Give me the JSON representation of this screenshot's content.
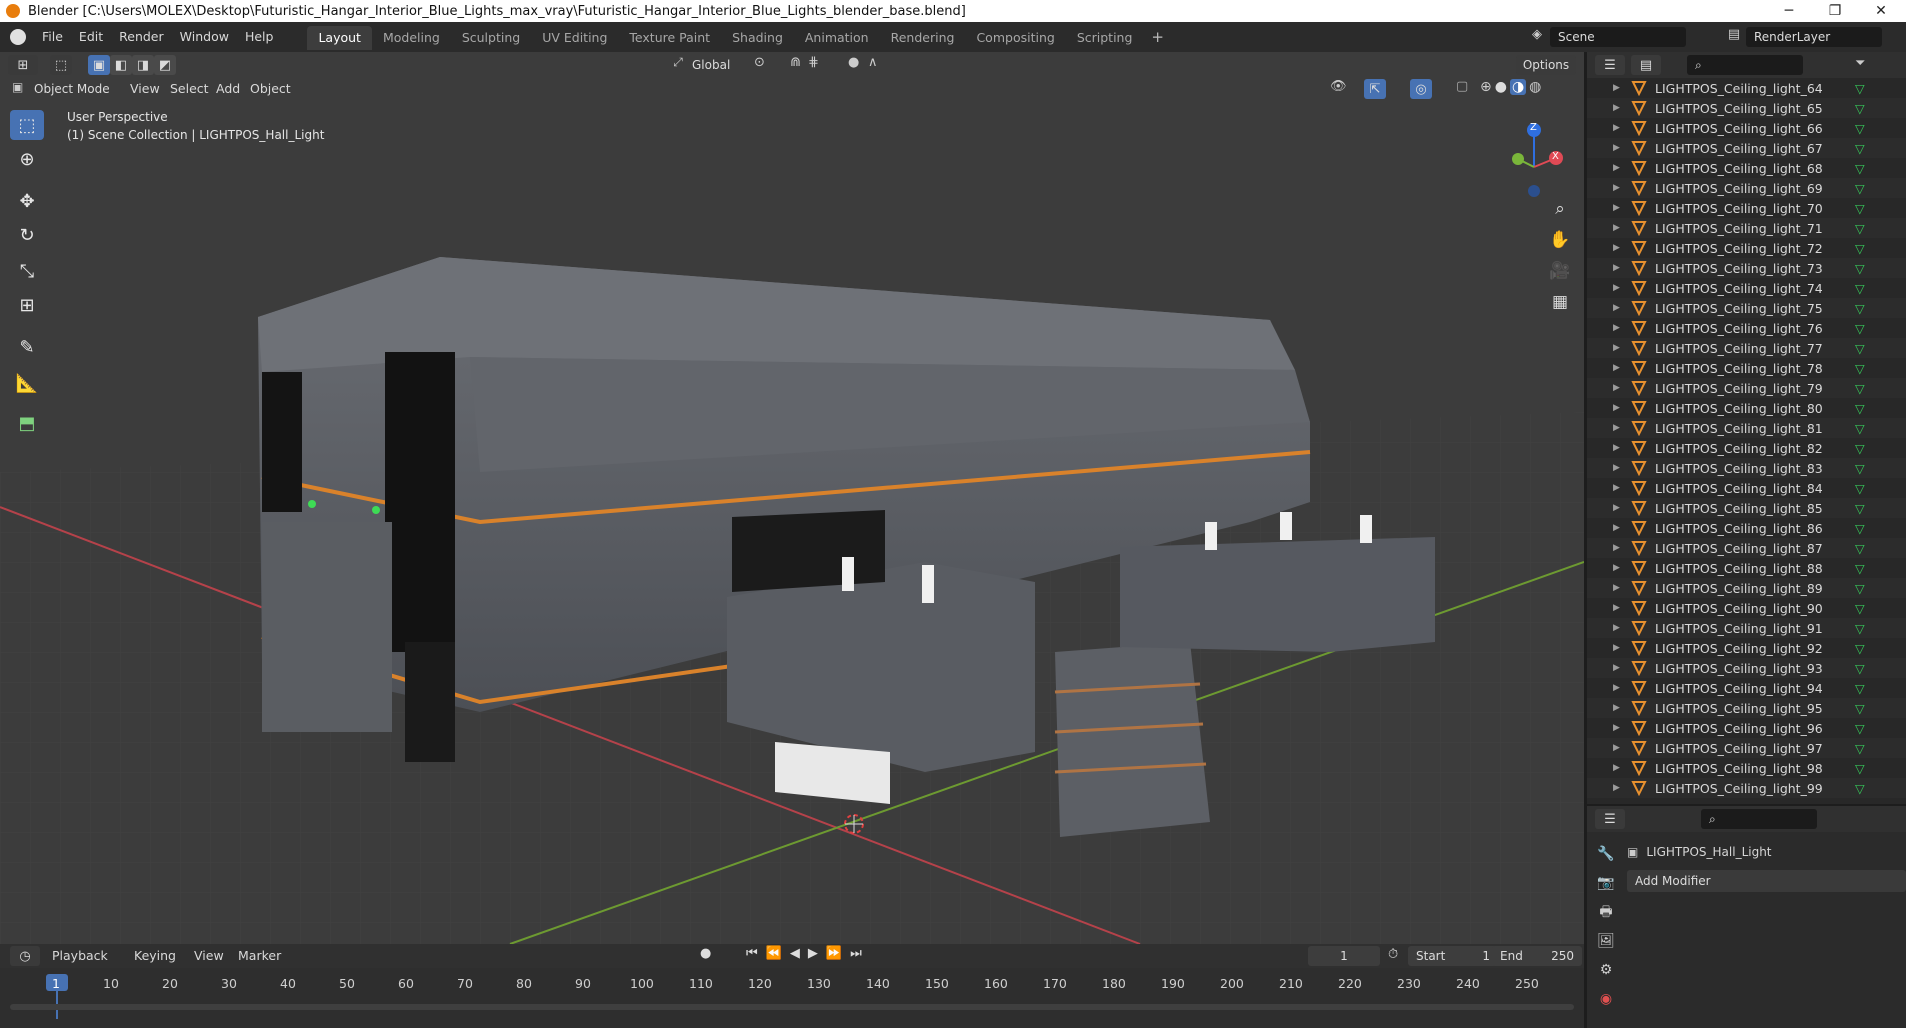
{
  "window": {
    "title": "Blender [C:\\Users\\MOLEX\\Desktop\\Futuristic_Hangar_Interior_Blue_Lights_max_vray\\Futuristic_Hangar_Interior_Blue_Lights_blender_base.blend]",
    "minimize": "─",
    "maximize": "❐",
    "close": "✕"
  },
  "menu": [
    "File",
    "Edit",
    "Render",
    "Window",
    "Help"
  ],
  "workspaces": [
    "Layout",
    "Modeling",
    "Sculpting",
    "UV Editing",
    "Texture Paint",
    "Shading",
    "Animation",
    "Rendering",
    "Compositing",
    "Scripting"
  ],
  "add_workspace": "+",
  "scene": "Scene",
  "view_layer": "RenderLayer",
  "viewport": {
    "transform_orientation": "Global",
    "options": "Options",
    "mode": "Object Mode",
    "header_menus": [
      "View",
      "Select",
      "Add",
      "Object"
    ],
    "overlay_title": "User Perspective",
    "overlay_sub": "(1) Scene Collection | LIGHTPOS_Hall_Light",
    "gizmo": {
      "z": "Z",
      "x": "X"
    }
  },
  "outliner": {
    "items": [
      "LIGHTPOS_Ceiling_light_64",
      "LIGHTPOS_Ceiling_light_65",
      "LIGHTPOS_Ceiling_light_66",
      "LIGHTPOS_Ceiling_light_67",
      "LIGHTPOS_Ceiling_light_68",
      "LIGHTPOS_Ceiling_light_69",
      "LIGHTPOS_Ceiling_light_70",
      "LIGHTPOS_Ceiling_light_71",
      "LIGHTPOS_Ceiling_light_72",
      "LIGHTPOS_Ceiling_light_73",
      "LIGHTPOS_Ceiling_light_74",
      "LIGHTPOS_Ceiling_light_75",
      "LIGHTPOS_Ceiling_light_76",
      "LIGHTPOS_Ceiling_light_77",
      "LIGHTPOS_Ceiling_light_78",
      "LIGHTPOS_Ceiling_light_79",
      "LIGHTPOS_Ceiling_light_80",
      "LIGHTPOS_Ceiling_light_81",
      "LIGHTPOS_Ceiling_light_82",
      "LIGHTPOS_Ceiling_light_83",
      "LIGHTPOS_Ceiling_light_84",
      "LIGHTPOS_Ceiling_light_85",
      "LIGHTPOS_Ceiling_light_86",
      "LIGHTPOS_Ceiling_light_87",
      "LIGHTPOS_Ceiling_light_88",
      "LIGHTPOS_Ceiling_light_89",
      "LIGHTPOS_Ceiling_light_90",
      "LIGHTPOS_Ceiling_light_91",
      "LIGHTPOS_Ceiling_light_92",
      "LIGHTPOS_Ceiling_light_93",
      "LIGHTPOS_Ceiling_light_94",
      "LIGHTPOS_Ceiling_light_95",
      "LIGHTPOS_Ceiling_light_96",
      "LIGHTPOS_Ceiling_light_97",
      "LIGHTPOS_Ceiling_light_98",
      "LIGHTPOS_Ceiling_light_99"
    ]
  },
  "properties": {
    "object_name": "LIGHTPOS_Hall_Light",
    "add_modifier": "Add Modifier"
  },
  "timeline": {
    "menus": [
      "Playback",
      "Keying",
      "View",
      "Marker"
    ],
    "current_frame": "1",
    "start_label": "Start",
    "start": "1",
    "end_label": "End",
    "end": "250",
    "ruler": [
      "1",
      "10",
      "20",
      "30",
      "40",
      "50",
      "60",
      "70",
      "80",
      "90",
      "100",
      "110",
      "120",
      "130",
      "140",
      "150",
      "160",
      "170",
      "180",
      "190",
      "200",
      "210",
      "220",
      "230",
      "240",
      "250"
    ]
  },
  "colors": {
    "accent": "#4772b3",
    "light_object": "#e8912f",
    "data_green": "#35c759",
    "axis_x": "#b5424a",
    "axis_y": "#6d9a31",
    "orange_trim": "#d9822b"
  }
}
